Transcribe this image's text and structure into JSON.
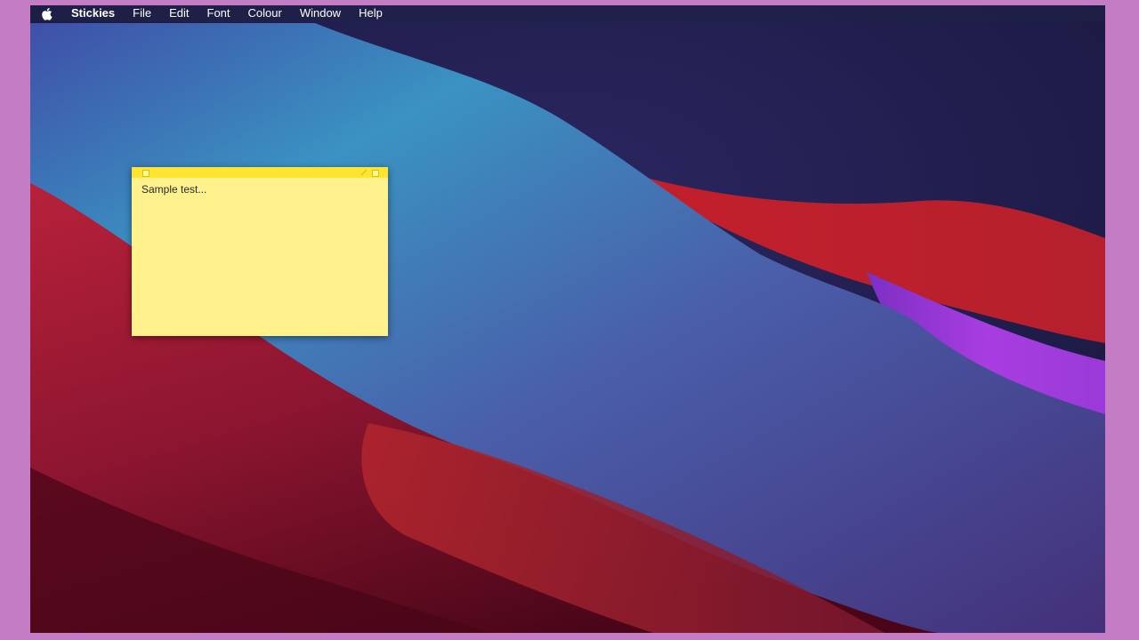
{
  "menubar": {
    "apple_icon": "apple-logo-icon",
    "app_name": "Stickies",
    "items": [
      "File",
      "Edit",
      "Font",
      "Colour",
      "Window",
      "Help"
    ]
  },
  "sticky_note": {
    "text": "Sample test...",
    "color": "#fff28c",
    "titlebar_color": "#ffe430"
  },
  "wallpaper": {
    "description_colors": [
      "#1d1b45",
      "#3a9ac4",
      "#4a3f96",
      "#c4202e",
      "#a83de0",
      "#5a0a1e"
    ]
  }
}
